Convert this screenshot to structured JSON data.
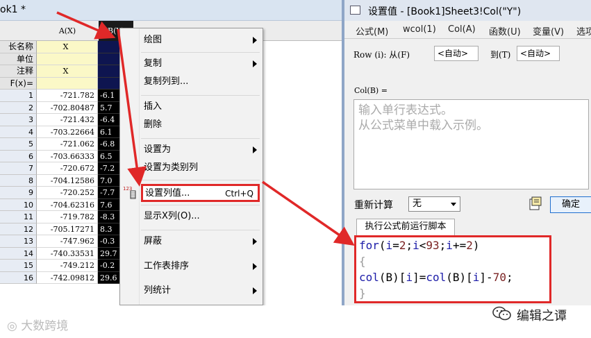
{
  "book": {
    "title": "ok1 *",
    "columns": {
      "a": "A(X)",
      "b": "B(Y)"
    },
    "meta_rows": [
      {
        "label": "长名称",
        "a": "X",
        "b": ""
      },
      {
        "label": "单位",
        "a": "",
        "b": ""
      },
      {
        "label": "注释",
        "a": "X",
        "b": ""
      },
      {
        "label": "F(x)=",
        "a": "",
        "b": ""
      }
    ],
    "rows": [
      {
        "n": "1",
        "a": "-721.782",
        "b": "-6.1"
      },
      {
        "n": "2",
        "a": "-702.80487",
        "b": "5.7"
      },
      {
        "n": "3",
        "a": "-721.432",
        "b": "-6.4"
      },
      {
        "n": "4",
        "a": "-703.22664",
        "b": "6.1"
      },
      {
        "n": "5",
        "a": "-721.062",
        "b": "-6.8"
      },
      {
        "n": "6",
        "a": "-703.66333",
        "b": "6.5"
      },
      {
        "n": "7",
        "a": "-720.672",
        "b": "-7.2"
      },
      {
        "n": "8",
        "a": "-704.12586",
        "b": "7.0"
      },
      {
        "n": "9",
        "a": "-720.252",
        "b": "-7.7"
      },
      {
        "n": "10",
        "a": "-704.62316",
        "b": "7.6"
      },
      {
        "n": "11",
        "a": "-719.782",
        "b": "-8.3"
      },
      {
        "n": "12",
        "a": "-705.17271",
        "b": "8.3"
      },
      {
        "n": "13",
        "a": "-747.962",
        "b": "-0.3"
      },
      {
        "n": "14",
        "a": "-740.33531",
        "b": "29.7"
      },
      {
        "n": "15",
        "a": "-749.212",
        "b": "-0.2"
      },
      {
        "n": "16",
        "a": "-742.09812",
        "b": "29.6"
      }
    ]
  },
  "context_menu": {
    "items": [
      {
        "label": "绘图",
        "submenu": true
      },
      {
        "label": "复制",
        "submenu": true
      },
      {
        "label": "复制列到...",
        "submenu": false
      },
      {
        "label": "插入",
        "submenu": false
      },
      {
        "label": "删除",
        "submenu": false
      },
      {
        "label": "设置为",
        "submenu": true
      },
      {
        "label": "设置为类别列",
        "submenu": false
      },
      {
        "label": "设置列值...",
        "submenu": false
      },
      {
        "label": "显示X列(O)...",
        "submenu": false
      },
      {
        "label": "屏蔽",
        "submenu": true
      },
      {
        "label": "工作表排序",
        "submenu": true
      },
      {
        "label": "列统计",
        "submenu": true
      }
    ],
    "highlighted_shortcut": "Ctrl+Q",
    "icon_label": "123"
  },
  "dialog": {
    "title": "设置值 - [Book1]Sheet3!Col(\"Y\")",
    "menu": [
      "公式(M)",
      "wcol(1)",
      "Col(A)",
      "函数(U)",
      "变量(V)",
      "选项"
    ],
    "row_label": "Row (i): 从(F)",
    "from_value": "<自动>",
    "to_label": "到(T)",
    "to_value": "<自动>",
    "col_label": "Col(B) =",
    "expression_placeholder": [
      "输入单行表达式。",
      "从公式菜单中载入示例。"
    ],
    "recalc_label": "重新计算",
    "recalc_value": "无",
    "ok_label": "确定",
    "script_tab": "执行公式前运行脚本",
    "script_lines": [
      "for(i=2;i<93;i+=2)",
      "{",
      "col(B)[i]=col(B)[i]-70;",
      "}"
    ]
  },
  "watermarks": {
    "left": "大数跨境",
    "right": "编辑之谭"
  },
  "colors": {
    "highlight_red": "#e02828",
    "selected_column": "#000000",
    "meta_yellow": "#fbf8c7"
  }
}
